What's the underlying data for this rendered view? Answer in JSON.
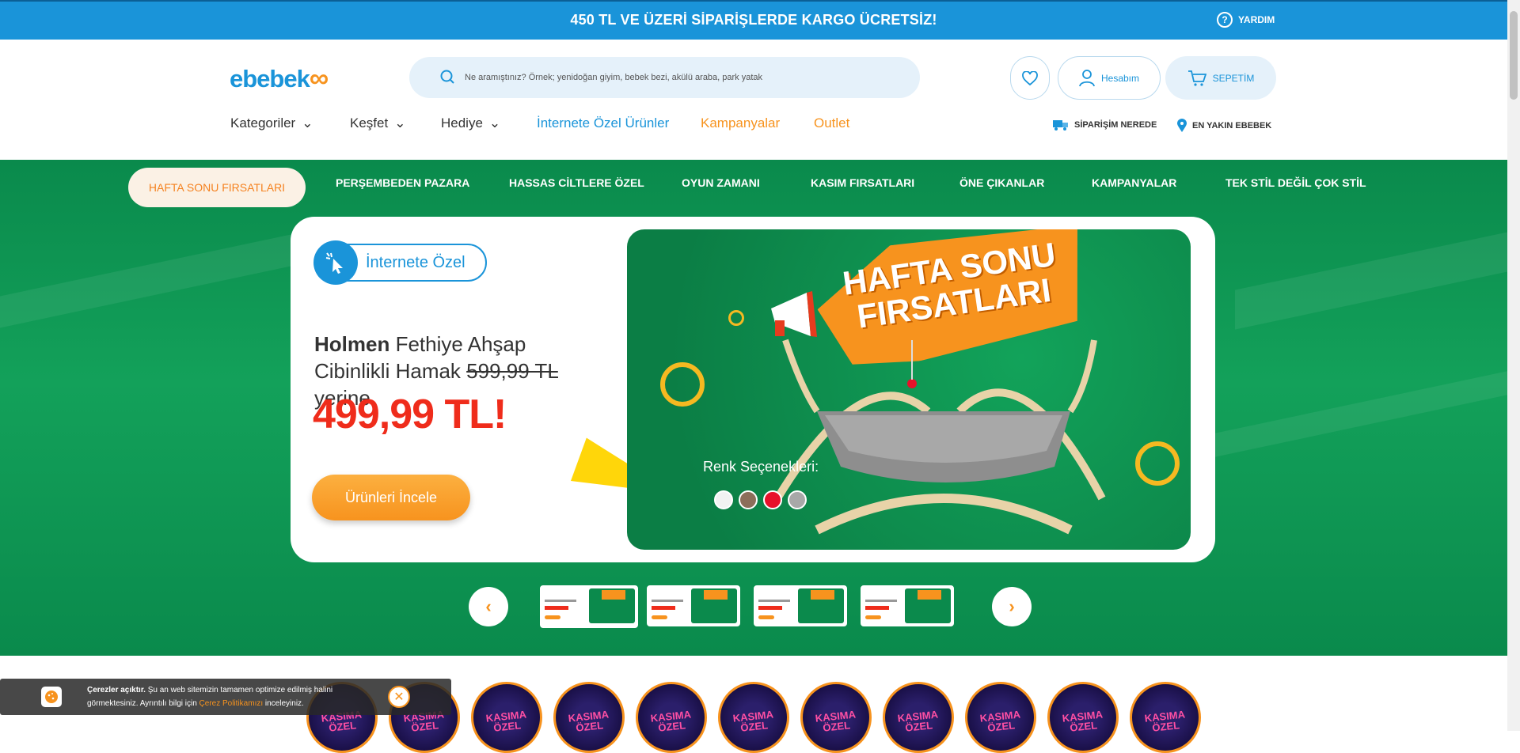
{
  "topbar": {
    "promo": "450 TL VE ÜZERİ SİPARİŞLERDE KARGO ÜCRETSİZ!",
    "help": "YARDIM"
  },
  "header": {
    "logo": "ebebek",
    "search_placeholder": "Ne aramıştınız? Örnek; yenidoğan giyim, bebek bezi, akülü araba, park yatak",
    "account": "Hesabım",
    "cart": "SEPETİM",
    "order_tracking": "SİPARİŞİM NEREDE",
    "nearest_store": "EN YAKIN EBEBEK"
  },
  "nav": {
    "items": [
      "Kategoriler",
      "Keşfet",
      "Hediye",
      "İnternete Özel Ürünler",
      "Kampanyalar",
      "Outlet"
    ]
  },
  "tabs": [
    "HAFTA SONU FIRSATLARI",
    "PERŞEMBEDEN PAZARA",
    "HASSAS CİLTLERE ÖZEL",
    "OYUN ZAMANI",
    "KASIM FIRSATLARI",
    "ÖNE ÇIKANLAR",
    "KAMPANYALAR",
    "TEK STİL DEĞİL ÇOK STİL"
  ],
  "hero": {
    "badge": "İnternete Özel",
    "brand": "Holmen",
    "product": " Fethiye Ahşap Cibinlikli Hamak ",
    "old_price": "599,99 TL",
    "instead": " yerine",
    "price": "499,99 TL!",
    "cta": "Ürünleri İncele",
    "burst_title": "HAFTA SONU FIRSATLARI",
    "color_options": "Renk Seçenekleri:",
    "colors": [
      "#f2f2f2",
      "#8c6e5a",
      "#e8102a",
      "#a8a8a8"
    ]
  },
  "stories": {
    "label": "KASIMA ÖZEL"
  },
  "cookie": {
    "title": "Çerezler açıktır.",
    "text": " Şu an web sitemizin tamamen optimize edilmiş halini görmektesiniz. Ayrıntılı bilgi için ",
    "link": "Çerez Politikamızı",
    "tail": " inceleyiniz."
  }
}
